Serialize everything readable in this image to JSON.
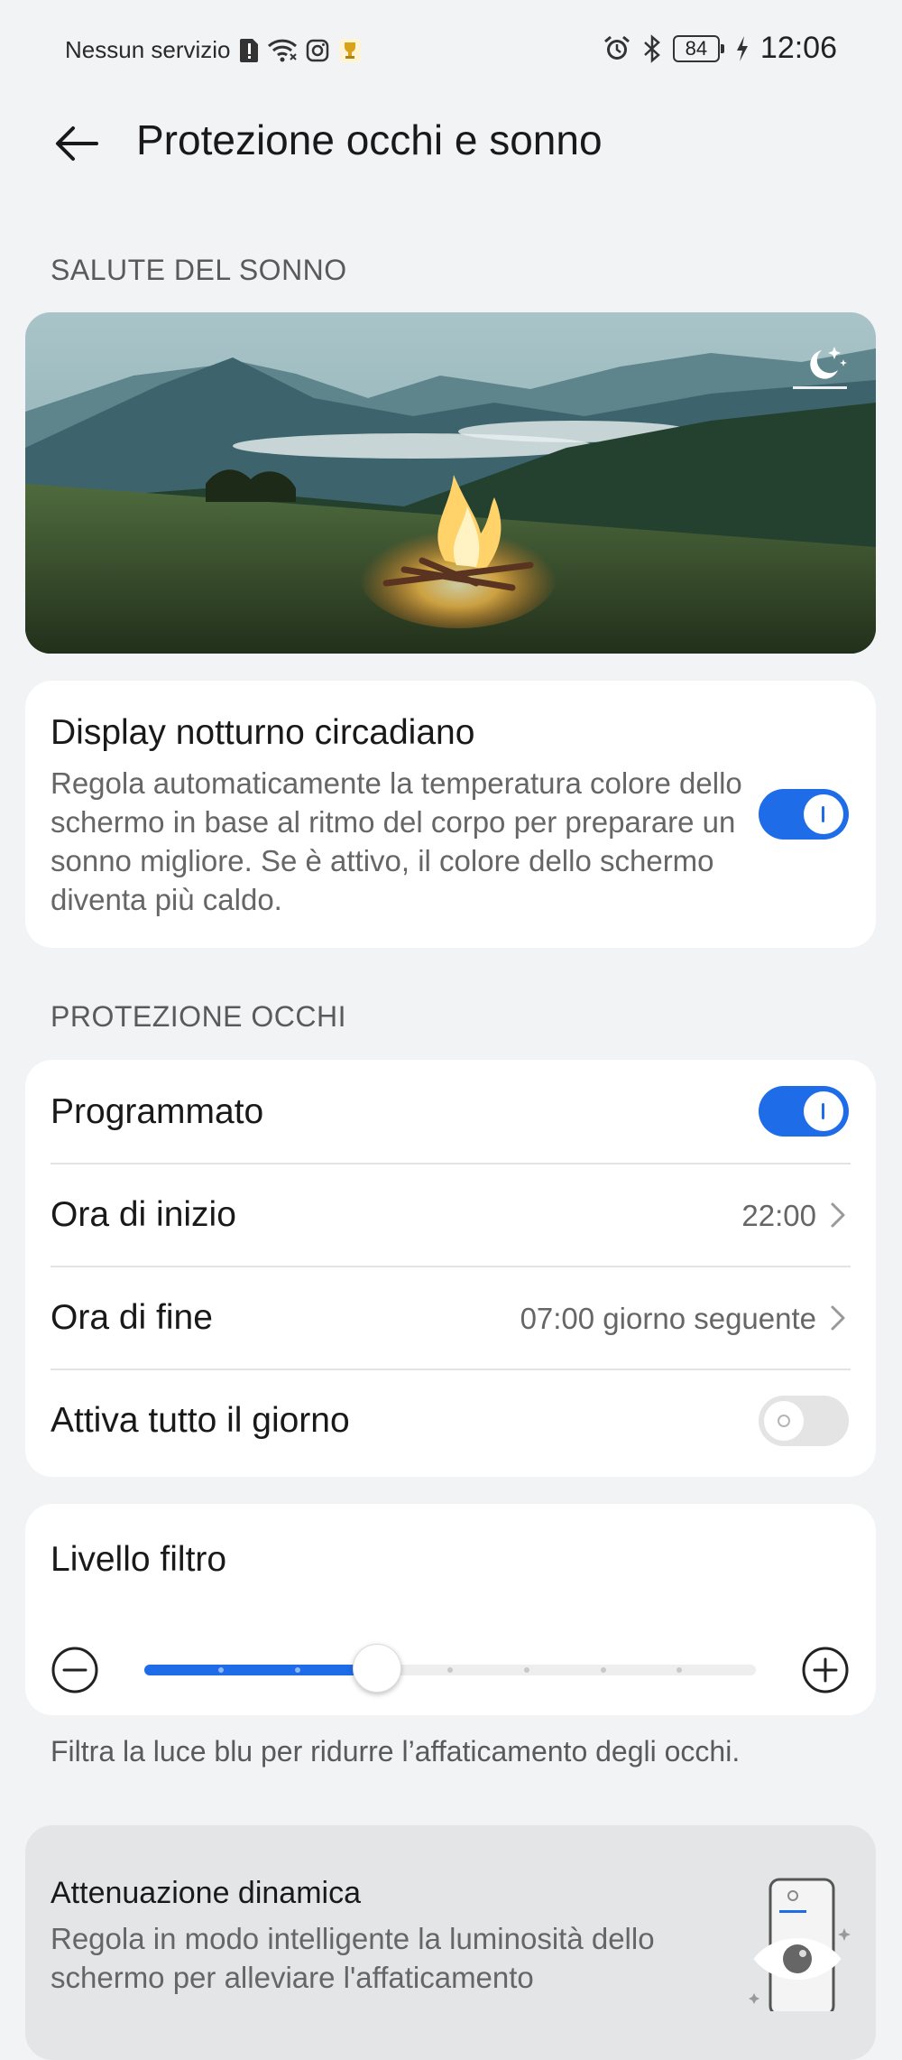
{
  "status_bar": {
    "carrier": "Nessun servizio",
    "battery": "84",
    "time": "12:06"
  },
  "header": {
    "title": "Protezione occhi e sonno"
  },
  "sleep_section": {
    "header": "SALUTE DEL SONNO",
    "circadian": {
      "title": "Display notturno circadiano",
      "description": "Regola automaticamente la temperatura colore dello schermo in base al ritmo del corpo per preparare un sonno migliore. Se è attivo, il colore dello schermo diventa più caldo.",
      "enabled": true
    }
  },
  "eye_section": {
    "header": "PROTEZIONE OCCHI",
    "scheduled": {
      "label": "Programmato",
      "enabled": true
    },
    "start": {
      "label": "Ora di inizio",
      "value": "22:00"
    },
    "end": {
      "label": "Ora di fine",
      "value": "07:00 giorno seguente"
    },
    "all_day": {
      "label": "Attiva tutto il giorno",
      "enabled": false
    }
  },
  "filter": {
    "title": "Livello filtro",
    "level_fraction": 0.38,
    "steps": 8,
    "note": "Filtra la luce blu per ridurre l’affaticamento degli occhi."
  },
  "dynamic": {
    "title": "Attenuazione dinamica",
    "description": "Regola in modo intelligente la luminosità dello schermo per alleviare l'affaticamento"
  },
  "colors": {
    "accent": "#1f6ce8",
    "background": "#f1f3f5",
    "card": "#ffffff"
  },
  "icons": [
    "no-sim-icon",
    "wifi-icon",
    "instagram-icon",
    "trophy-icon",
    "alarm-icon",
    "bluetooth-icon",
    "battery-icon",
    "charging-icon",
    "back-arrow-icon",
    "moon-stars-icon",
    "chevron-right-icon",
    "minus-circle-icon",
    "plus-circle-icon",
    "eye-icon"
  ]
}
